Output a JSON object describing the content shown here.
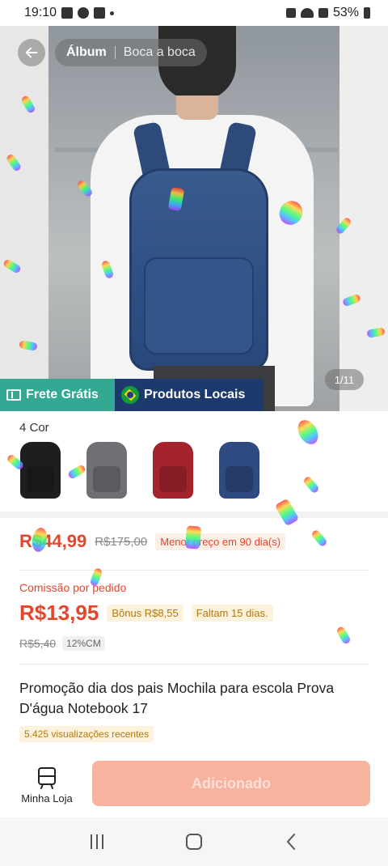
{
  "status_bar": {
    "time": "19:10",
    "battery": "53%"
  },
  "gallery": {
    "tabs": [
      {
        "label": "Álbum",
        "active": true
      },
      {
        "label": "Boca a boca",
        "active": false
      }
    ],
    "page_indicator": "1/11"
  },
  "banner": {
    "free_shipping": "Frete Grátis",
    "local_products": "Produtos Locais"
  },
  "colors": {
    "label": "4 Cor",
    "swatches": [
      {
        "name": "black",
        "color": "#1e1e20"
      },
      {
        "name": "gray",
        "color": "#6e7074"
      },
      {
        "name": "red",
        "color": "#a4232c"
      },
      {
        "name": "blue",
        "color": "#2e4a80"
      }
    ]
  },
  "price": {
    "current": "R$44,99",
    "original": "R$175,00",
    "note": "Menor preço em 90 dia(s)"
  },
  "commission": {
    "label": "Comissão por pedido",
    "value": "R$13,95",
    "bonus": "Bônus R$8,55",
    "days_left": "Faltam 15 dias.",
    "old_value": "R$5,40",
    "rate": "12%CM"
  },
  "product": {
    "title": "Promoção dia dos pais Mochila para escola Prova D'água Notebook 17",
    "views": "5.425 visualizações recentes"
  },
  "actions": {
    "store_label": "Minha Loja",
    "add_label": "Adicionado"
  },
  "theme": {
    "accent": "#e4462c",
    "shipping_green": "#35a894",
    "local_navy": "#1d3a6e",
    "button_disabled": "#f8b3a0"
  }
}
